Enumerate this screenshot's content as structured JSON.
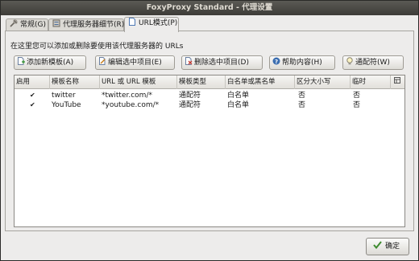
{
  "window": {
    "title": "FoxyProxy Standard - 代理设置"
  },
  "tabs": [
    {
      "label": "常规(G)",
      "icon": "tools-icon"
    },
    {
      "label": "代理服务器细节(R)",
      "icon": "server-icon"
    },
    {
      "label": "URL模式(P)",
      "icon": "page-icon",
      "active": true
    }
  ],
  "panel": {
    "description": "在这里您可以添加或删除要使用该代理服务器的 URLs"
  },
  "toolbar": {
    "add_label": "添加新模板(A)",
    "edit_label": "编辑选中项目(E)",
    "delete_label": "删除选中项目(D)",
    "help_label": "帮助内容(H)",
    "wildcard_label": "通配符(W)"
  },
  "table": {
    "columns": [
      "启用",
      "模板名称",
      "URL 或 URL 模板",
      "模板类型",
      "白名单或黑名单",
      "区分大小写",
      "临时"
    ],
    "rows": [
      {
        "enabled": "✔",
        "name": "twitter",
        "url": "*twitter.com/*",
        "type": "通配符",
        "list": "白名单",
        "case": "否",
        "temp": "否"
      },
      {
        "enabled": "✔",
        "name": "YouTube",
        "url": "*youtube.com/*",
        "type": "通配符",
        "list": "白名单",
        "case": "否",
        "temp": "否"
      }
    ]
  },
  "footer": {
    "ok_label": "确定"
  },
  "colors": {
    "title_bar": "#4b4a46",
    "window_bg": "#edeceb",
    "check_green": "#3d8b2f"
  }
}
